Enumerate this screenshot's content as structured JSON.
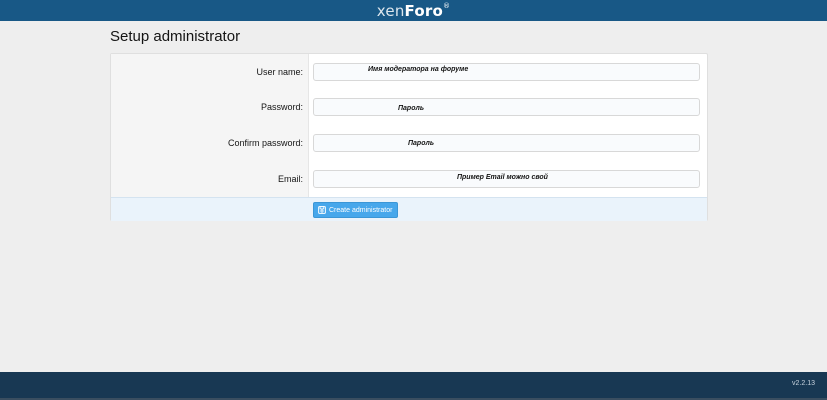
{
  "header": {
    "logo_light": "xen",
    "logo_bold": "Foro",
    "logo_mark": "®"
  },
  "page": {
    "title": "Setup administrator"
  },
  "form": {
    "fields": [
      {
        "label": "User name:",
        "value": "Имя модератора на форуме"
      },
      {
        "label": "Password:",
        "value": "Пароль"
      },
      {
        "label": "Confirm password:",
        "value": "Пароль"
      },
      {
        "label": "Email:",
        "value": "Пример Email можно свой"
      }
    ],
    "submit_label": "Create administrator"
  },
  "footer": {
    "version": "v2.2.13"
  },
  "colors": {
    "header_bg": "#185886",
    "footer_bg": "#183853",
    "button_bg": "#47a7eb"
  }
}
